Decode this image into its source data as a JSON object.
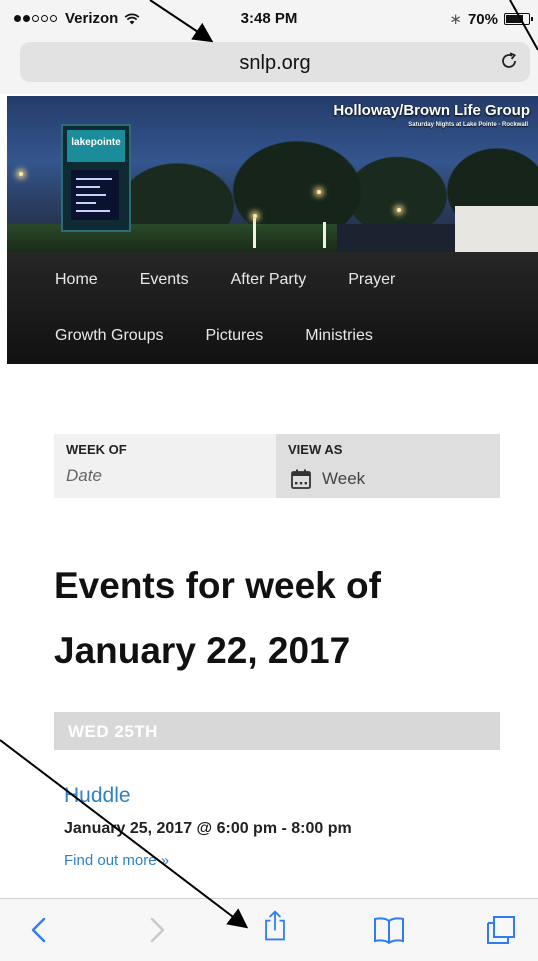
{
  "status_bar": {
    "carrier": "Verizon",
    "time": "3:48 PM",
    "battery": "70%",
    "battery_level": 0.7,
    "signal_strength": 2,
    "icons": [
      "signal-dots-icon",
      "wifi-icon",
      "bluetooth-icon",
      "battery-icon"
    ]
  },
  "browser": {
    "url": "snlp.org",
    "icons": [
      "reload-icon"
    ]
  },
  "hero": {
    "title": "Holloway/Brown Life Group",
    "subtitle": "Saturday Nights at Lake Pointe - Rockwall",
    "sign_text": "lakepointe"
  },
  "nav": {
    "row1": [
      "Home",
      "Events",
      "After Party",
      "Prayer"
    ],
    "row2": [
      "Growth Groups",
      "Pictures",
      "Ministries"
    ]
  },
  "filter": {
    "week_of_label": "WEEK OF",
    "date_placeholder": "Date",
    "view_as_label": "VIEW AS",
    "view_as_value": "Week",
    "icons": [
      "calendar-icon"
    ]
  },
  "heading": "Events for week of January 22, 2017",
  "day": {
    "label": "WED 25TH"
  },
  "event": {
    "title": "Huddle",
    "time": "January 25, 2017 @ 6:00 pm - 8:00 pm",
    "link": "Find out more »"
  },
  "toolbar": {
    "icons": [
      "back-icon",
      "forward-icon",
      "share-icon",
      "bookmarks-icon",
      "tabs-icon"
    ]
  },
  "colors": {
    "link": "#2f82c6",
    "nav_bg": "#1a1a1a",
    "day_header_bg": "#d8d8d8",
    "ios_tint": "#2f7df6"
  }
}
